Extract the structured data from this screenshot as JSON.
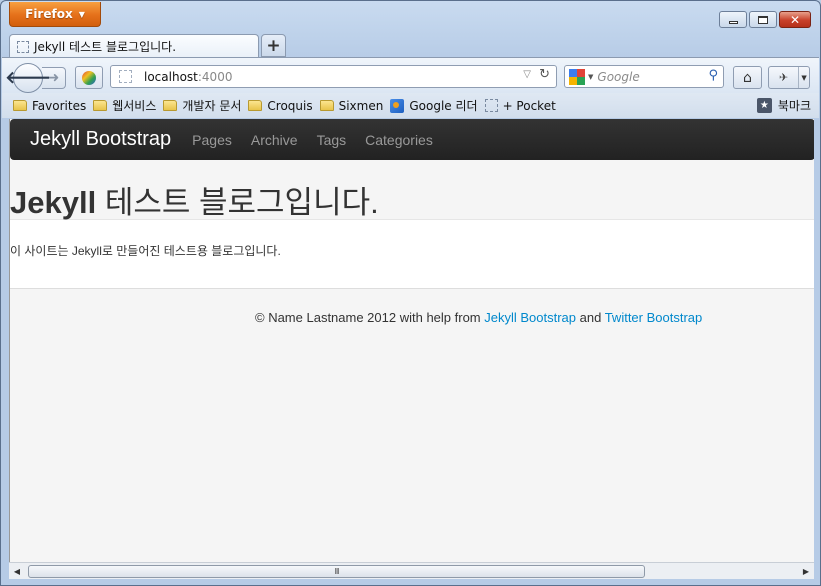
{
  "browser": {
    "app_button": "Firefox",
    "tab_title": "Jekyll 테스트 블로그입니다.",
    "new_tab": "+",
    "url_host": "localhost",
    "url_port": ":4000",
    "search_placeholder": "Google"
  },
  "bookmarks": {
    "items": [
      "Favorites",
      "웹서비스",
      "개발자 문서",
      "Croquis",
      "Sixmen",
      "Google 리더",
      "+ Pocket"
    ],
    "right_label": "북마크"
  },
  "site": {
    "brand": "Jekyll Bootstrap",
    "nav": [
      "Pages",
      "Archive",
      "Tags",
      "Categories"
    ],
    "title_bold": "Jekyll",
    "title_rest": " 테스트 블로그입니다.",
    "body": "이 사이트는 Jekyll로 만들어진 테스트용 블로그입니다.",
    "footer_prefix": "© Name Lastname 2012 with help from ",
    "footer_link1": "Jekyll Bootstrap",
    "footer_mid": " and ",
    "footer_link2": "Twitter Bootstrap"
  },
  "scrollbar": {
    "grip": "III"
  }
}
